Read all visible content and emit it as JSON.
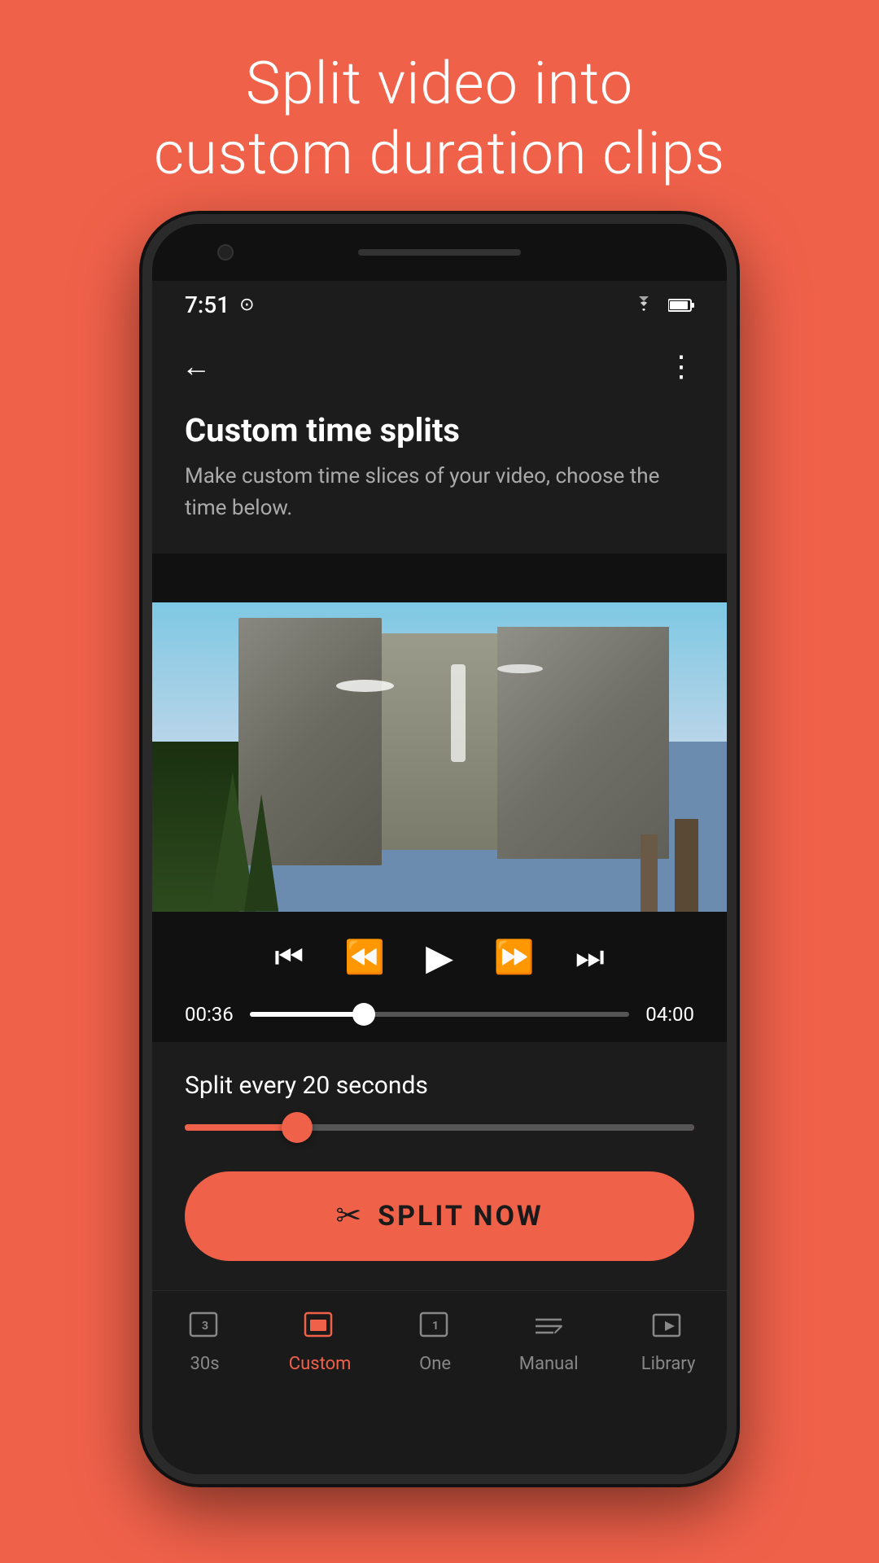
{
  "hero": {
    "title": "Split video into\ncustom duration clips"
  },
  "status_bar": {
    "time": "7:51",
    "wifi_icon": "wifi",
    "battery_icon": "battery"
  },
  "app_bar": {
    "back_label": "←",
    "more_label": "⋮"
  },
  "header": {
    "title": "Custom time splits",
    "subtitle": "Make custom time slices of your video, choose the time below."
  },
  "video_controls": {
    "time_current": "00:36",
    "time_total": "04:00"
  },
  "split_section": {
    "label": "Split every 20 seconds"
  },
  "split_button": {
    "label": "SPLIT NOW"
  },
  "bottom_nav": {
    "items": [
      {
        "id": "30s",
        "label": "30s",
        "active": false
      },
      {
        "id": "custom",
        "label": "Custom",
        "active": true
      },
      {
        "id": "one",
        "label": "One",
        "active": false
      },
      {
        "id": "manual",
        "label": "Manual",
        "active": false
      },
      {
        "id": "library",
        "label": "Library",
        "active": false
      }
    ]
  },
  "colors": {
    "accent": "#F0614A",
    "background": "#F0614A",
    "phone_bg": "#1c1c1c",
    "dark": "#111"
  }
}
